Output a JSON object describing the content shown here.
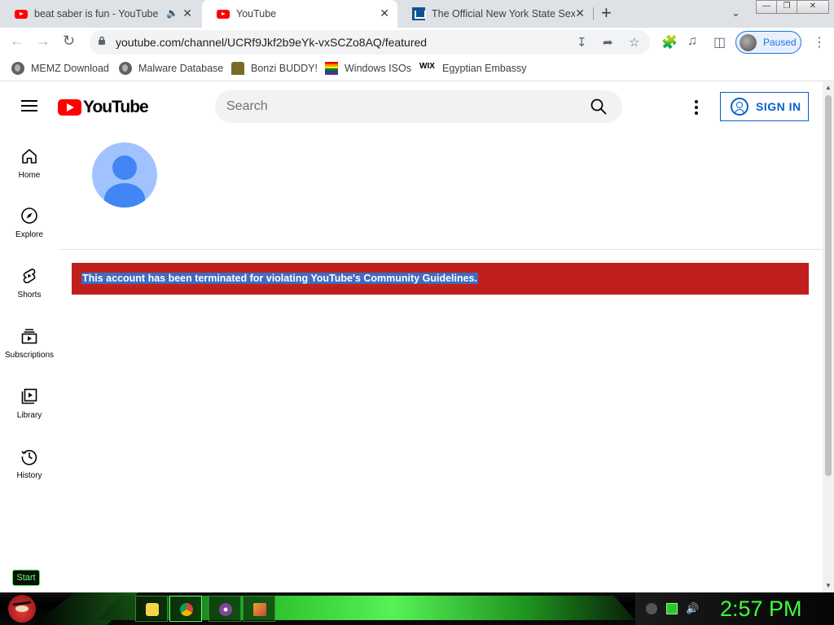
{
  "browser": {
    "tabs": [
      {
        "title": "beat saber is fun - YouTube",
        "favicon": "youtube-icon",
        "audio": true
      },
      {
        "title": "YouTube",
        "favicon": "youtube-icon",
        "active": true
      },
      {
        "title": "The Official New York State Sex C",
        "favicon": "website-icon"
      }
    ],
    "address_bar": {
      "url": "youtube.com/channel/UCRf9Jkf2b9eYk-vxSCZo8AQ/featured"
    },
    "profile": {
      "status": "Paused"
    },
    "bookmarks": [
      {
        "label": "MEMZ Download",
        "icon": "globe-icon"
      },
      {
        "label": "Malware Database",
        "icon": "globe-icon"
      },
      {
        "label": "Bonzi BUDDY!",
        "icon": "bonzi-icon"
      },
      {
        "label": "Windows ISOs",
        "icon": "rainbow-flag-icon"
      },
      {
        "label": "Egyptian Embassy",
        "icon": "wix-icon",
        "icon_text": "WIX"
      }
    ]
  },
  "youtube": {
    "logo_text": "YouTube",
    "search": {
      "placeholder": "Search"
    },
    "sign_in": "SIGN IN",
    "sidebar": [
      {
        "label": "Home",
        "icon": "home-icon"
      },
      {
        "label": "Explore",
        "icon": "compass-icon"
      },
      {
        "label": "Shorts",
        "icon": "shorts-icon"
      },
      {
        "label": "Subscriptions",
        "icon": "subscriptions-icon"
      },
      {
        "label": "Library",
        "icon": "library-icon"
      },
      {
        "label": "History",
        "icon": "history-icon"
      }
    ],
    "alert": "This account has been terminated for violating YouTube's Community Guidelines."
  },
  "taskbar": {
    "start_label": "Start",
    "clock": "2:57 PM"
  },
  "colors": {
    "youtube_red": "#ff0000",
    "alert_background": "#c0201d",
    "link_blue": "#065fd4",
    "taskbar_green": "#3dff3d"
  }
}
